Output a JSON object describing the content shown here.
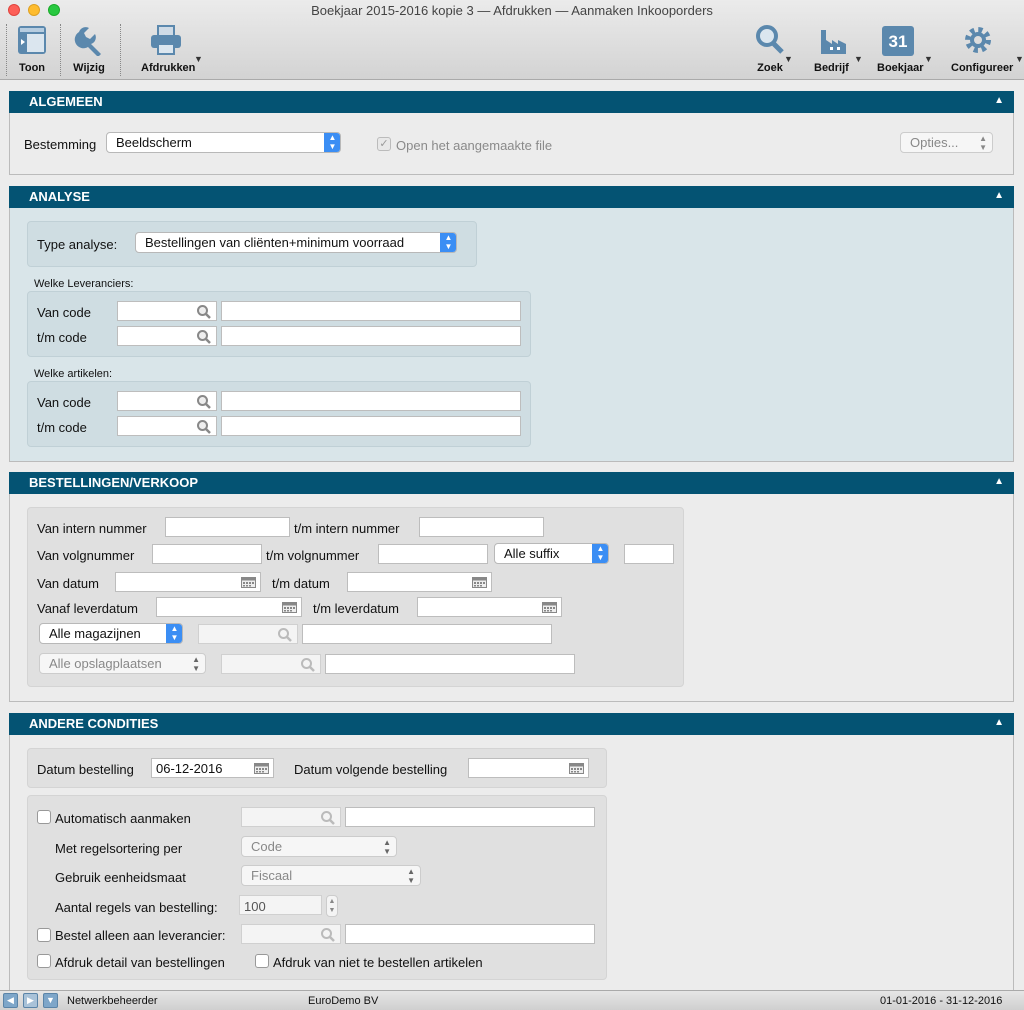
{
  "window": {
    "title": "Boekjaar 2015-2016 kopie 3 — Afdrukken — Aanmaken Inkooporders"
  },
  "toolbar": {
    "toon": "Toon",
    "wijzig": "Wijzig",
    "afdrukken": "Afdrukken",
    "zoek": "Zoek",
    "bedrijf": "Bedrijf",
    "boekjaar": "Boekjaar",
    "boekjaar_day": "31",
    "configureer": "Configureer"
  },
  "algemeen": {
    "title": "ALGEMEEN",
    "bestemming_label": "Bestemming",
    "bestemming_value": "Beeldscherm",
    "open_file_label": "Open het aangemaakte file",
    "opties_label": "Opties..."
  },
  "analyse": {
    "title": "ANALYSE",
    "type_label": "Type analyse:",
    "type_value": "Bestellingen van cliënten+minimum voorraad",
    "leveranciers_label": "Welke Leveranciers:",
    "artikelen_label": "Welke artikelen:",
    "van_code": "Van code",
    "tm_code": "t/m code"
  },
  "bestellingen": {
    "title": "BESTELLINGEN/VERKOOP",
    "van_intern": "Van intern nummer",
    "tm_intern": "t/m intern nummer",
    "van_volg": "Van volgnummer",
    "tm_volg": "t/m volgnummer",
    "suffix_value": "Alle suffix",
    "van_datum": "Van datum",
    "tm_datum": "t/m datum",
    "vanaf_lever": "Vanaf leverdatum",
    "tm_lever": "t/m leverdatum",
    "magazijnen_value": "Alle magazijnen",
    "opslag_value": "Alle opslagplaatsen"
  },
  "andere": {
    "title": "ANDERE CONDITIES",
    "datum_best_label": "Datum bestelling",
    "datum_best_value": "06-12-2016",
    "datum_volg_label": "Datum volgende bestelling",
    "auto_label": "Automatisch aanmaken",
    "regelsort_label": "Met regelsortering per",
    "regelsort_value": "Code",
    "eenheid_label": "Gebruik eenheidsmaat",
    "eenheid_value": "Fiscaal",
    "aantal_label": "Aantal regels van bestelling:",
    "aantal_value": "100",
    "bestel_lev_label": "Bestel alleen aan leverancier:",
    "afdruk_detail_label": "Afdruk detail van bestellingen",
    "afdruk_niet_label": "Afdruk van niet te bestellen artikelen"
  },
  "status": {
    "user": "Netwerkbeheerder",
    "company": "EuroDemo BV",
    "period": "01-01-2016 - 31-12-2016"
  },
  "colors": {
    "header": "#045373",
    "accent": "#3b8ef4",
    "analyse_bg": "#d9e5e9"
  },
  "icons": [
    "view-icon",
    "wrench-icon",
    "printer-icon",
    "magnifier-icon",
    "factory-icon",
    "calendar-icon",
    "gear-icon"
  ]
}
